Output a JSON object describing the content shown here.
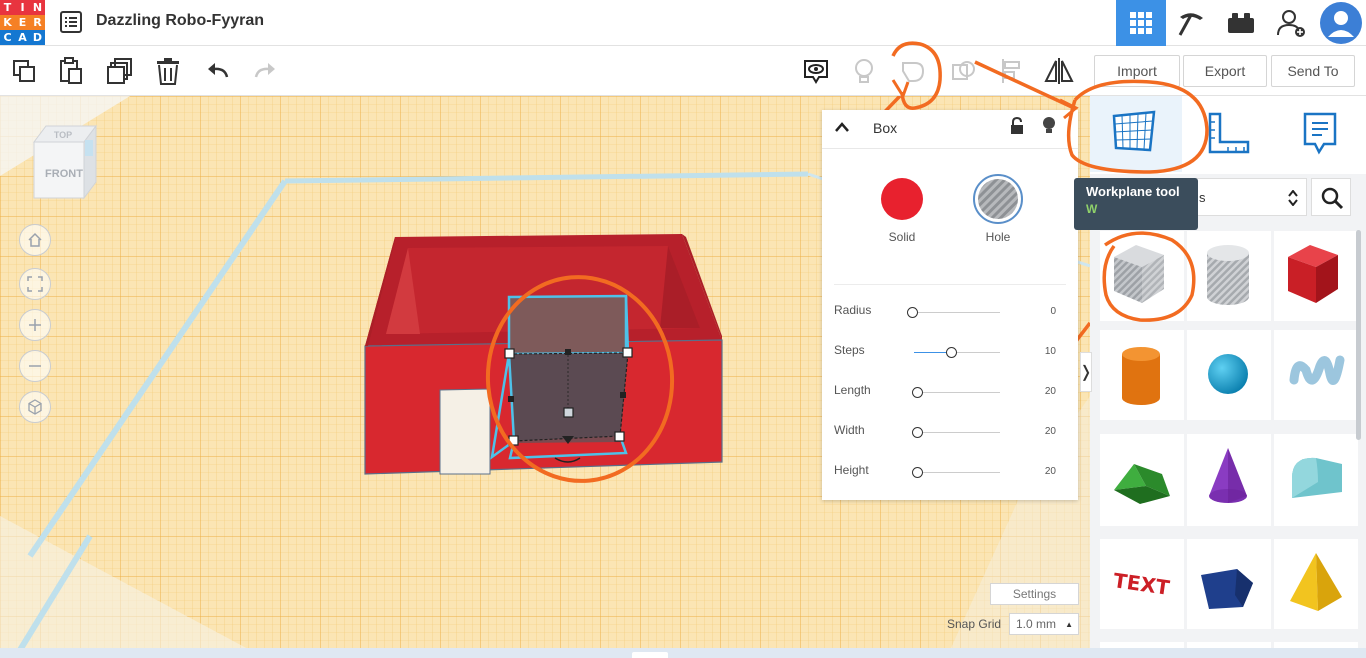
{
  "app": {
    "logo_letters": [
      "T",
      "I",
      "N",
      "K",
      "E",
      "R",
      "C",
      "A",
      "D"
    ],
    "logo_colors": [
      "#e8343f",
      "#e8343f",
      "#e8343f",
      "#f58025",
      "#f58025",
      "#f58025",
      "#1477d1",
      "#1477d1",
      "#1477d1"
    ],
    "title": "Dazzling Robo-Fyyran"
  },
  "header": {
    "icons": [
      "3d-design-grid-icon",
      "pickaxe-icon",
      "brick-icon",
      "add-user-icon",
      "user-avatar-icon"
    ],
    "active_color": "#3c91e6"
  },
  "toolbar": {
    "left_icons": [
      "copy-icon",
      "paste-icon",
      "duplicate-icon",
      "delete-icon",
      "undo-icon",
      "redo-icon"
    ],
    "right_icons": [
      "notes-icon",
      "light-bulb-icon",
      "group-icon",
      "ungroup-icon",
      "align-icon",
      "mirror-icon"
    ],
    "import_label": "Import",
    "export_label": "Export",
    "sendto_label": "Send To"
  },
  "inspector": {
    "shape_name": "Box",
    "solid_label": "Solid",
    "hole_label": "Hole",
    "solid_color": "#e8212e",
    "properties": [
      {
        "label": "Radius",
        "value": "0",
        "fraction": 0.0
      },
      {
        "label": "Steps",
        "value": "10",
        "fraction": 0.45
      },
      {
        "label": "Length",
        "value": "20",
        "fraction": 0.06
      },
      {
        "label": "Width",
        "value": "20",
        "fraction": 0.06
      },
      {
        "label": "Height",
        "value": "20",
        "fraction": 0.06
      }
    ]
  },
  "viewcube": {
    "top": "TOP",
    "front": "FRONT"
  },
  "tooltip": {
    "title": "Workplane tool",
    "shortcut": "W",
    "behind_text": "s"
  },
  "footer": {
    "settings_label": "Settings",
    "snap_grid_label": "Snap Grid",
    "snap_grid_value": "1.0 mm"
  },
  "annotation_color": "#f26b21",
  "shapes": [
    "box-hole",
    "cylinder-hole",
    "box",
    "cylinder",
    "sphere",
    "scribble",
    "roof",
    "cone",
    "round-roof",
    "text",
    "polygon",
    "pyramid"
  ]
}
